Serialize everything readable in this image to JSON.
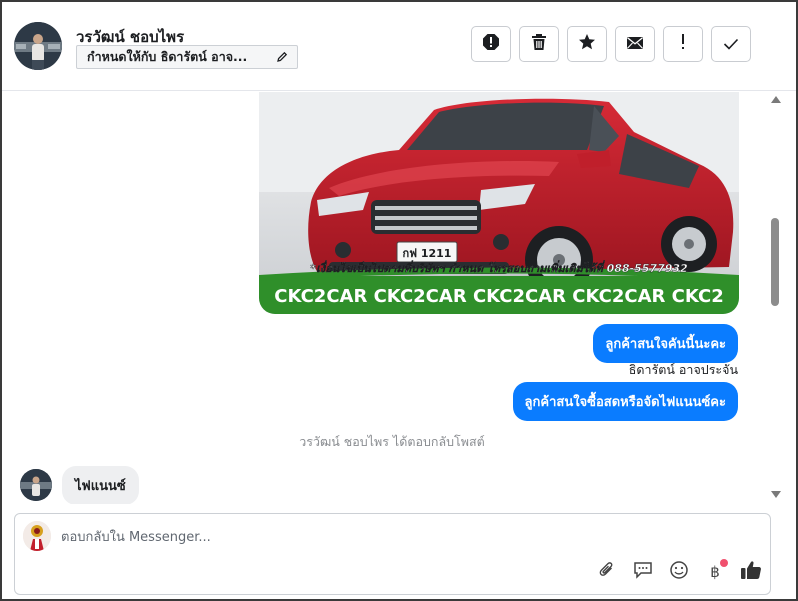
{
  "header": {
    "contact_name": "วรวัฒน์ ชอบไพร",
    "assign_label": "กำหนดให้กับ ธิดารัตน์ อาจ..."
  },
  "messages": {
    "image_caption": "*เงื่อนไขเป็นไปตามที่บริษัทฯ กำหนด โทรสอบถามเพิ่มเติมได้ที่ 088-5577932",
    "image_banner": "CKC2CAR CKC2CAR CKC2CAR CKC2CAR CKC2",
    "plate_text": "กฟ 1211",
    "outgoing_1": "ลูกค้าสนใจคันนี้นะคะ",
    "sender_name": "ธิดารัตน์ อาจประจัน",
    "outgoing_2": "ลูกค้าสนใจซื้อสดหรือจัดไฟแนนซ์คะ",
    "system_notice": "วรวัฒน์ ชอบไพร ได้ตอบกลับโพสต์",
    "incoming_1": "ไฟแนนซ์"
  },
  "composer": {
    "placeholder": "ตอบกลับใน Messenger...",
    "baht_symbol": "฿"
  },
  "colors": {
    "accent": "#0a7cff",
    "incoming_bubble": "#eeeff1",
    "banner_green": "#2f8f2a",
    "car_red": "#c8202e",
    "notification_dot": "#f0506e"
  },
  "icons": {
    "actions": [
      "spam-icon",
      "trash-icon",
      "star-icon",
      "envelope-icon",
      "exclamation-icon",
      "checkmark-icon"
    ],
    "composer": [
      "paperclip-icon",
      "chat-bubble-icon",
      "emoji-icon",
      "baht-icon",
      "thumbs-up-icon"
    ]
  }
}
